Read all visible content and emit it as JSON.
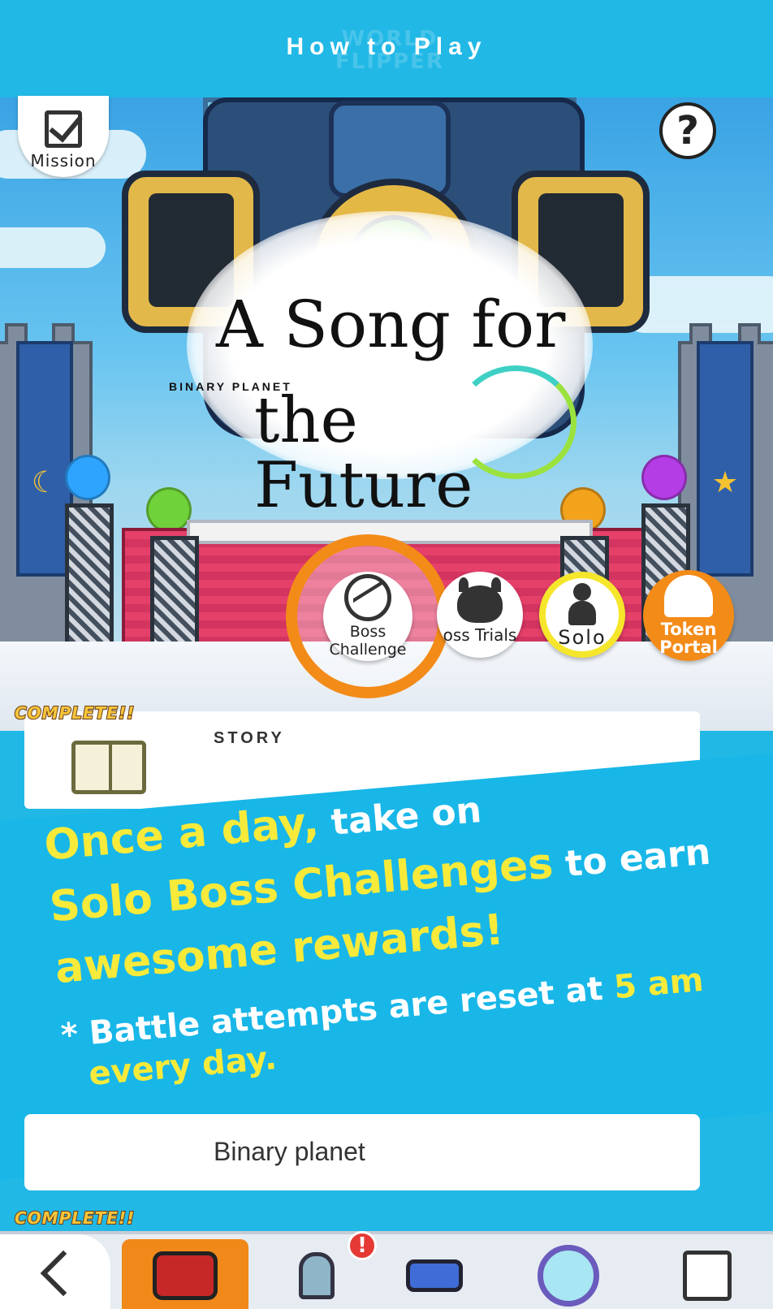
{
  "header": {
    "title": "How to Play",
    "logo_text": "WORLD FLIPPER"
  },
  "scene": {
    "event_title_line1": "A Song for",
    "event_title_line2": "the Future",
    "event_subtitle": "BINARY PLANET"
  },
  "buttons": {
    "mission_label": "Mission",
    "help_symbol": "?",
    "boss_challenge_label_1": "Boss",
    "boss_challenge_label_2": "Challenge",
    "boss_trials_label": "oss Trials",
    "solo_label": "Solo",
    "token_portal_label_1": "Token",
    "token_portal_label_2": "Portal"
  },
  "story": {
    "section_label": "STORY",
    "complete_badge_1": "COMPLETE!!",
    "complete_badge_2": "COMPLETE!!",
    "lower_item_title": "Binary planet"
  },
  "promo": {
    "line1_yellow": "Once a day,",
    "line1_white": " take on",
    "line2_yellow": "Solo Boss Challenges",
    "line2_white": " to earn",
    "line3_yellow": "awesome rewards!",
    "note_white": "* Battle attempts are reset at ",
    "note_yellow_time": "5 am",
    "note_yellow_end": "every day."
  },
  "nav": {
    "alert_badge": "!",
    "icons": [
      "back-arrow-icon",
      "home-icon",
      "character-icon",
      "party-icon",
      "gacha-icon",
      "menu-icon"
    ]
  },
  "colors": {
    "primary_blue": "#21b8e6",
    "accent_orange": "#f38b18",
    "highlight_yellow": "#f7ea3a",
    "solo_ring_yellow": "#f5e62c"
  }
}
